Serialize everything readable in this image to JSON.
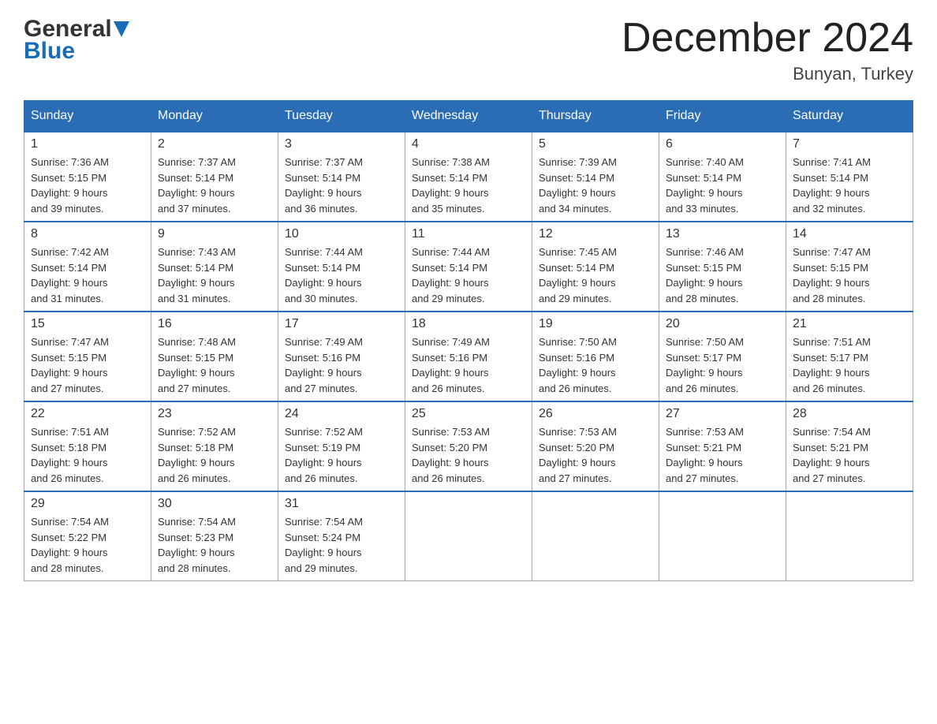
{
  "logo": {
    "line1_general": "General",
    "line1_triangle": "▶",
    "line2_blue": "Blue"
  },
  "title": "December 2024",
  "subtitle": "Bunyan, Turkey",
  "days_of_week": [
    "Sunday",
    "Monday",
    "Tuesday",
    "Wednesday",
    "Thursday",
    "Friday",
    "Saturday"
  ],
  "weeks": [
    [
      {
        "day": "1",
        "sunrise": "7:36 AM",
        "sunset": "5:15 PM",
        "daylight": "9 hours and 39 minutes."
      },
      {
        "day": "2",
        "sunrise": "7:37 AM",
        "sunset": "5:14 PM",
        "daylight": "9 hours and 37 minutes."
      },
      {
        "day": "3",
        "sunrise": "7:37 AM",
        "sunset": "5:14 PM",
        "daylight": "9 hours and 36 minutes."
      },
      {
        "day": "4",
        "sunrise": "7:38 AM",
        "sunset": "5:14 PM",
        "daylight": "9 hours and 35 minutes."
      },
      {
        "day": "5",
        "sunrise": "7:39 AM",
        "sunset": "5:14 PM",
        "daylight": "9 hours and 34 minutes."
      },
      {
        "day": "6",
        "sunrise": "7:40 AM",
        "sunset": "5:14 PM",
        "daylight": "9 hours and 33 minutes."
      },
      {
        "day": "7",
        "sunrise": "7:41 AM",
        "sunset": "5:14 PM",
        "daylight": "9 hours and 32 minutes."
      }
    ],
    [
      {
        "day": "8",
        "sunrise": "7:42 AM",
        "sunset": "5:14 PM",
        "daylight": "9 hours and 31 minutes."
      },
      {
        "day": "9",
        "sunrise": "7:43 AM",
        "sunset": "5:14 PM",
        "daylight": "9 hours and 31 minutes."
      },
      {
        "day": "10",
        "sunrise": "7:44 AM",
        "sunset": "5:14 PM",
        "daylight": "9 hours and 30 minutes."
      },
      {
        "day": "11",
        "sunrise": "7:44 AM",
        "sunset": "5:14 PM",
        "daylight": "9 hours and 29 minutes."
      },
      {
        "day": "12",
        "sunrise": "7:45 AM",
        "sunset": "5:14 PM",
        "daylight": "9 hours and 29 minutes."
      },
      {
        "day": "13",
        "sunrise": "7:46 AM",
        "sunset": "5:15 PM",
        "daylight": "9 hours and 28 minutes."
      },
      {
        "day": "14",
        "sunrise": "7:47 AM",
        "sunset": "5:15 PM",
        "daylight": "9 hours and 28 minutes."
      }
    ],
    [
      {
        "day": "15",
        "sunrise": "7:47 AM",
        "sunset": "5:15 PM",
        "daylight": "9 hours and 27 minutes."
      },
      {
        "day": "16",
        "sunrise": "7:48 AM",
        "sunset": "5:15 PM",
        "daylight": "9 hours and 27 minutes."
      },
      {
        "day": "17",
        "sunrise": "7:49 AM",
        "sunset": "5:16 PM",
        "daylight": "9 hours and 27 minutes."
      },
      {
        "day": "18",
        "sunrise": "7:49 AM",
        "sunset": "5:16 PM",
        "daylight": "9 hours and 26 minutes."
      },
      {
        "day": "19",
        "sunrise": "7:50 AM",
        "sunset": "5:16 PM",
        "daylight": "9 hours and 26 minutes."
      },
      {
        "day": "20",
        "sunrise": "7:50 AM",
        "sunset": "5:17 PM",
        "daylight": "9 hours and 26 minutes."
      },
      {
        "day": "21",
        "sunrise": "7:51 AM",
        "sunset": "5:17 PM",
        "daylight": "9 hours and 26 minutes."
      }
    ],
    [
      {
        "day": "22",
        "sunrise": "7:51 AM",
        "sunset": "5:18 PM",
        "daylight": "9 hours and 26 minutes."
      },
      {
        "day": "23",
        "sunrise": "7:52 AM",
        "sunset": "5:18 PM",
        "daylight": "9 hours and 26 minutes."
      },
      {
        "day": "24",
        "sunrise": "7:52 AM",
        "sunset": "5:19 PM",
        "daylight": "9 hours and 26 minutes."
      },
      {
        "day": "25",
        "sunrise": "7:53 AM",
        "sunset": "5:20 PM",
        "daylight": "9 hours and 26 minutes."
      },
      {
        "day": "26",
        "sunrise": "7:53 AM",
        "sunset": "5:20 PM",
        "daylight": "9 hours and 27 minutes."
      },
      {
        "day": "27",
        "sunrise": "7:53 AM",
        "sunset": "5:21 PM",
        "daylight": "9 hours and 27 minutes."
      },
      {
        "day": "28",
        "sunrise": "7:54 AM",
        "sunset": "5:21 PM",
        "daylight": "9 hours and 27 minutes."
      }
    ],
    [
      {
        "day": "29",
        "sunrise": "7:54 AM",
        "sunset": "5:22 PM",
        "daylight": "9 hours and 28 minutes."
      },
      {
        "day": "30",
        "sunrise": "7:54 AM",
        "sunset": "5:23 PM",
        "daylight": "9 hours and 28 minutes."
      },
      {
        "day": "31",
        "sunrise": "7:54 AM",
        "sunset": "5:24 PM",
        "daylight": "9 hours and 29 minutes."
      },
      null,
      null,
      null,
      null
    ]
  ]
}
